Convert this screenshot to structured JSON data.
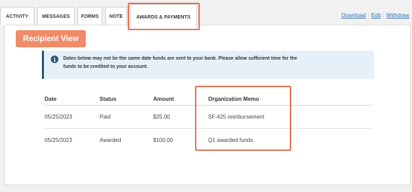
{
  "tabs": [
    {
      "label": "ACTIVITY"
    },
    {
      "label": "MESSAGES"
    },
    {
      "label": "FORMS"
    },
    {
      "label": "NOTE"
    },
    {
      "label": "AWARDS & PAYMENTS"
    }
  ],
  "links": {
    "download": "Download",
    "edit": "Edit",
    "withdraw": "Withdraw",
    "separator": "|"
  },
  "recipient_view_label": "Recipient View",
  "info": {
    "icon": "info-icon",
    "text": "Dates below may not be the same date funds are sent to your bank. Please allow sufficient time for the funds to be credited to your account."
  },
  "table": {
    "headers": [
      "Date",
      "Status",
      "Amount",
      "Organization Memo"
    ],
    "rows": [
      [
        "05/25/2023",
        "Paid",
        "$25.00",
        "SF-425 reimbursement"
      ],
      [
        "05/25/2023",
        "Awarded",
        "$100.00",
        "Q1 awarded funds."
      ]
    ]
  },
  "colors": {
    "accent": "#f08a68",
    "highlight": "#e8704f",
    "info_bg": "#e5f0f9",
    "info_bar": "#2d5470",
    "link": "#2f6fb5"
  }
}
